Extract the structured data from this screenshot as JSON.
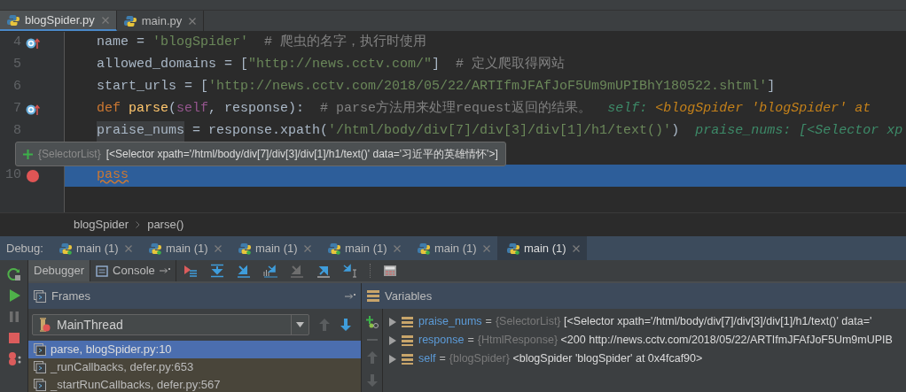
{
  "editor_tabs": [
    {
      "label": "blogSpider.py",
      "selected": true
    },
    {
      "label": "main.py",
      "selected": false
    }
  ],
  "code_lines": [
    {
      "number": "4",
      "override": true,
      "breakpoint": false,
      "current": false,
      "segments": [
        {
          "kind": "plain",
          "text": "name = "
        },
        {
          "kind": "string",
          "text": "'blogSpider'"
        },
        {
          "kind": "comment",
          "text": "  # 爬虫的名字，执行时使用"
        }
      ]
    },
    {
      "number": "5",
      "override": false,
      "breakpoint": false,
      "current": false,
      "segments": [
        {
          "kind": "plain",
          "text": "allowed_domains = ["
        },
        {
          "kind": "string",
          "text": "\"http://news.cctv.com/\""
        },
        {
          "kind": "plain",
          "text": "]"
        },
        {
          "kind": "comment",
          "text": "  # 定义爬取得网站"
        }
      ]
    },
    {
      "number": "6",
      "override": false,
      "breakpoint": false,
      "current": false,
      "segments": [
        {
          "kind": "plain",
          "text": "start_urls = ["
        },
        {
          "kind": "string",
          "text": "'http://news.cctv.com/2018/05/22/ARTIfmJFAfJoF5Um9mUPIBhY180522.shtml'"
        },
        {
          "kind": "plain",
          "text": "]"
        }
      ]
    },
    {
      "number": "7",
      "override": true,
      "breakpoint": false,
      "current": false,
      "segments": [
        {
          "kind": "keyword",
          "text": "def "
        },
        {
          "kind": "func",
          "text": "parse"
        },
        {
          "kind": "plain",
          "text": "("
        },
        {
          "kind": "self",
          "text": "self"
        },
        {
          "kind": "plain",
          "text": ", response):"
        },
        {
          "kind": "comment",
          "text": "  # parse方法用来处理request返回的结果。"
        },
        {
          "kind": "hint_name",
          "text": "  self: "
        },
        {
          "kind": "hint_value",
          "text": "<blogSpider 'blogSpider' at"
        }
      ]
    },
    {
      "number": "8",
      "override": false,
      "breakpoint": false,
      "current": false,
      "segments": [
        {
          "kind": "hovered",
          "text": "praise_nums"
        },
        {
          "kind": "plain",
          "text": " = response.xpath("
        },
        {
          "kind": "string",
          "text": "'/html/body/div[7]/div[3]/div[1]/h1/text()'"
        },
        {
          "kind": "plain",
          "text": ")"
        },
        {
          "kind": "hint_name",
          "text": "  praise_nums: [<Selector xp"
        }
      ]
    },
    {
      "number": "10",
      "override": false,
      "breakpoint": true,
      "current": true,
      "segments": [
        {
          "kind": "keyword",
          "text": "pass"
        }
      ]
    }
  ],
  "tooltip": {
    "type": "{SelectorList}",
    "value": "[<Selector xpath='/html/body/div[7]/div[3]/div[1]/h1/text()' data='习近平的英雄情怀'>]"
  },
  "breadcrumb": [
    "blogSpider",
    "parse()"
  ],
  "debug": {
    "label": "Debug:",
    "tabs": [
      {
        "label": "main (1)",
        "selected": false
      },
      {
        "label": "main (1)",
        "selected": false
      },
      {
        "label": "main (1)",
        "selected": false
      },
      {
        "label": "main (1)",
        "selected": false
      },
      {
        "label": "main (1)",
        "selected": false
      },
      {
        "label": "main (1)",
        "selected": true
      }
    ]
  },
  "debugger_tabs": [
    {
      "label": "Debugger",
      "selected": true
    },
    {
      "label": "Console",
      "selected": false
    }
  ],
  "frames": {
    "title": "Frames",
    "thread": "MainThread",
    "items": [
      {
        "label": "parse, blogSpider.py:10",
        "selected": true
      },
      {
        "label": "_runCallbacks, defer.py:653",
        "selected": false
      },
      {
        "label": "_startRunCallbacks, defer.py:567",
        "selected": false
      }
    ]
  },
  "variables": {
    "title": "Variables",
    "items": [
      {
        "name": "praise_nums",
        "operator": "=",
        "type": "{SelectorList}",
        "value": "[<Selector xpath='/html/body/div[7]/div[3]/div[1]/h1/text()' data='"
      },
      {
        "name": "response",
        "operator": "=",
        "type": "{HtmlResponse}",
        "value": "<200 http://news.cctv.com/2018/05/22/ARTIfmJFAfJoF5Um9mUPIB"
      },
      {
        "name": "self",
        "operator": "=",
        "type": "{blogSpider}",
        "value": "<blogSpider 'blogSpider' at 0x4fcaf90>"
      }
    ]
  }
}
